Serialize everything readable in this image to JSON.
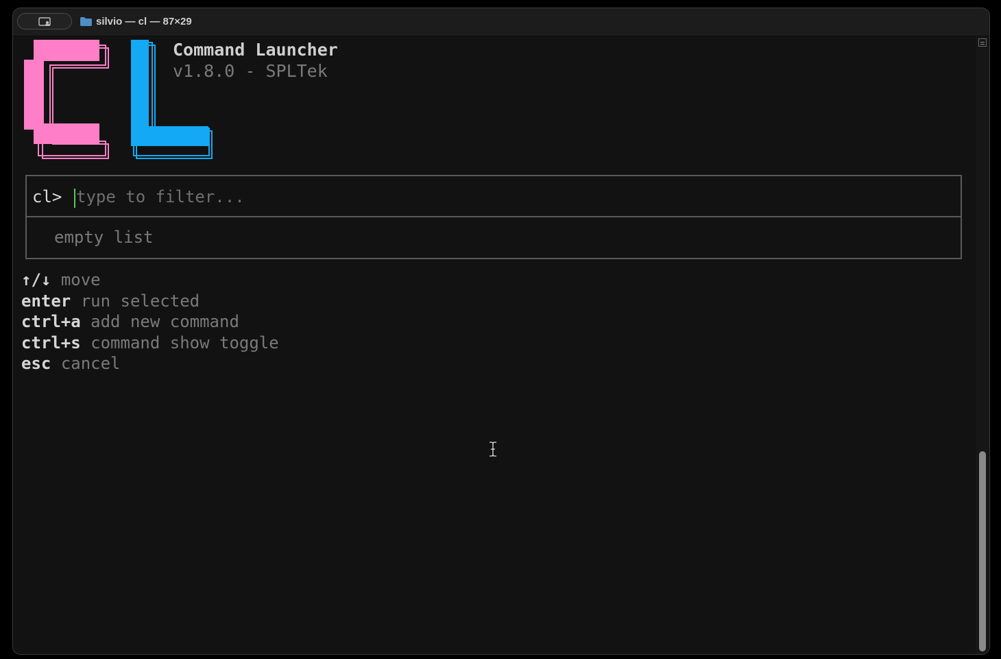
{
  "window": {
    "title": "silvio — cl — 87×29"
  },
  "header": {
    "app_name": "Command Launcher",
    "version_line": "v1.8.0 - SPLTek"
  },
  "logo": {
    "text": "CL",
    "colors": {
      "c": "#ff7ec8",
      "l": "#13a9f4"
    }
  },
  "filter": {
    "prompt": "cl>",
    "placeholder": "type to filter...",
    "value": ""
  },
  "list": {
    "empty_text": "empty list"
  },
  "help": [
    {
      "key": "↑/↓",
      "desc": "move"
    },
    {
      "key": "enter",
      "desc": "run selected"
    },
    {
      "key": "ctrl+a",
      "desc": "add new command"
    },
    {
      "key": "ctrl+s",
      "desc": "command show toggle"
    },
    {
      "key": "esc",
      "desc": "cancel"
    }
  ],
  "colors": {
    "background": "#121212",
    "caret": "#5ac85a"
  },
  "icons": {
    "titlebar_button": "profile-icon",
    "title_folder": "folder-icon",
    "mouse_cursor": "text-cursor-icon"
  }
}
